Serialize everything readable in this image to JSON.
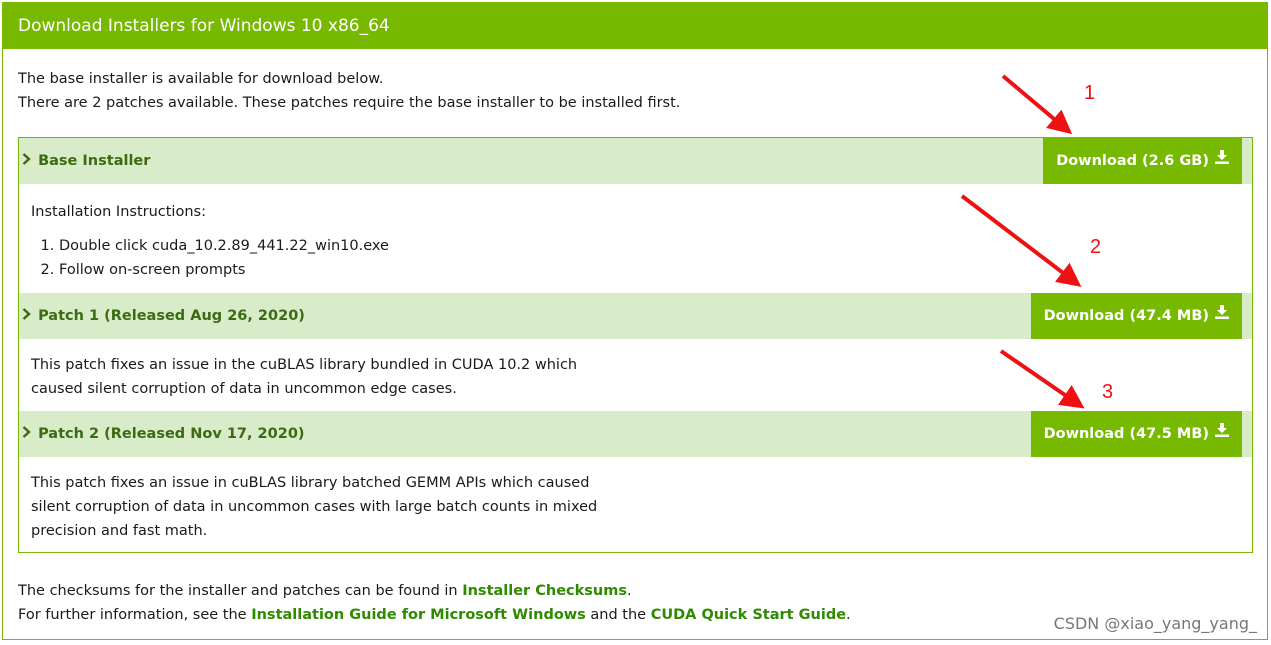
{
  "header": {
    "title": "Download Installers for Windows 10 x86_64"
  },
  "intro": {
    "line1": "The base installer is available for download below.",
    "line2": "There are 2 patches available. These patches require the base installer to be installed first."
  },
  "sections": [
    {
      "title": "Base Installer",
      "button": "Download (2.6 GB)",
      "instructions_label": "Installation Instructions:",
      "steps": [
        "Double click cuda_10.2.89_441.22_win10.exe",
        "Follow on-screen prompts"
      ]
    },
    {
      "title": "Patch 1 (Released Aug 26, 2020)",
      "button": "Download (47.4 MB)",
      "desc_line1": "This patch fixes an issue in the cuBLAS library bundled in CUDA 10.2 which",
      "desc_line2": "caused silent corruption of data in uncommon edge cases."
    },
    {
      "title": "Patch 2 (Released Nov 17, 2020)",
      "button": "Download (47.5 MB)",
      "desc_line1": "This patch fixes an issue in cuBLAS library batched GEMM APIs which caused",
      "desc_line2": "silent corruption of data in uncommon cases with large batch counts in mixed",
      "desc_line3": "precision and fast math."
    }
  ],
  "footer": {
    "line1_prefix": "The checksums for the installer and patches can be found in ",
    "checksums_link": "Installer Checksums",
    "line1_suffix": ".",
    "line2_prefix": "For further information, see the ",
    "install_guide_link": "Installation Guide for Microsoft Windows",
    "line2_mid": " and the ",
    "quickstart_link": "CUDA Quick Start Guide",
    "line2_suffix": "."
  },
  "annotations": [
    "1",
    "2",
    "3"
  ],
  "watermark": "CSDN @xiao_yang_yang_",
  "colors": {
    "accent": "#76b900",
    "row_bg": "#d8ecc9",
    "link": "#2e8b00",
    "annotation": "#ee1111"
  },
  "icons": {
    "chevron": "chevron-right-icon",
    "download": "download-icon"
  }
}
